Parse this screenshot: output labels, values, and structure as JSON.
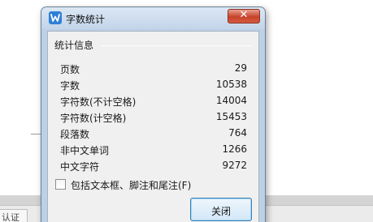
{
  "dialog": {
    "title": "字数统计",
    "close_glyph": "✕",
    "group_title": "统计信息",
    "stats": [
      {
        "label": "页数",
        "value": "29"
      },
      {
        "label": "字数",
        "value": "10538"
      },
      {
        "label": "字符数(不计空格)",
        "value": "14004"
      },
      {
        "label": "字符数(计空格)",
        "value": "15453"
      },
      {
        "label": "段落数",
        "value": "764"
      },
      {
        "label": "非中文单词",
        "value": "1266"
      },
      {
        "label": "中文字符",
        "value": "9272"
      }
    ],
    "include_checkbox": {
      "label": "包括文本框、脚注和尾注(F)",
      "checked": false
    },
    "close_button_label": "关闭"
  },
  "background": {
    "tab_label": "认证"
  },
  "colors": {
    "close_red": "#c7432b",
    "title_bar": "#c3d5ea",
    "app_icon": "#2f7fd6"
  }
}
